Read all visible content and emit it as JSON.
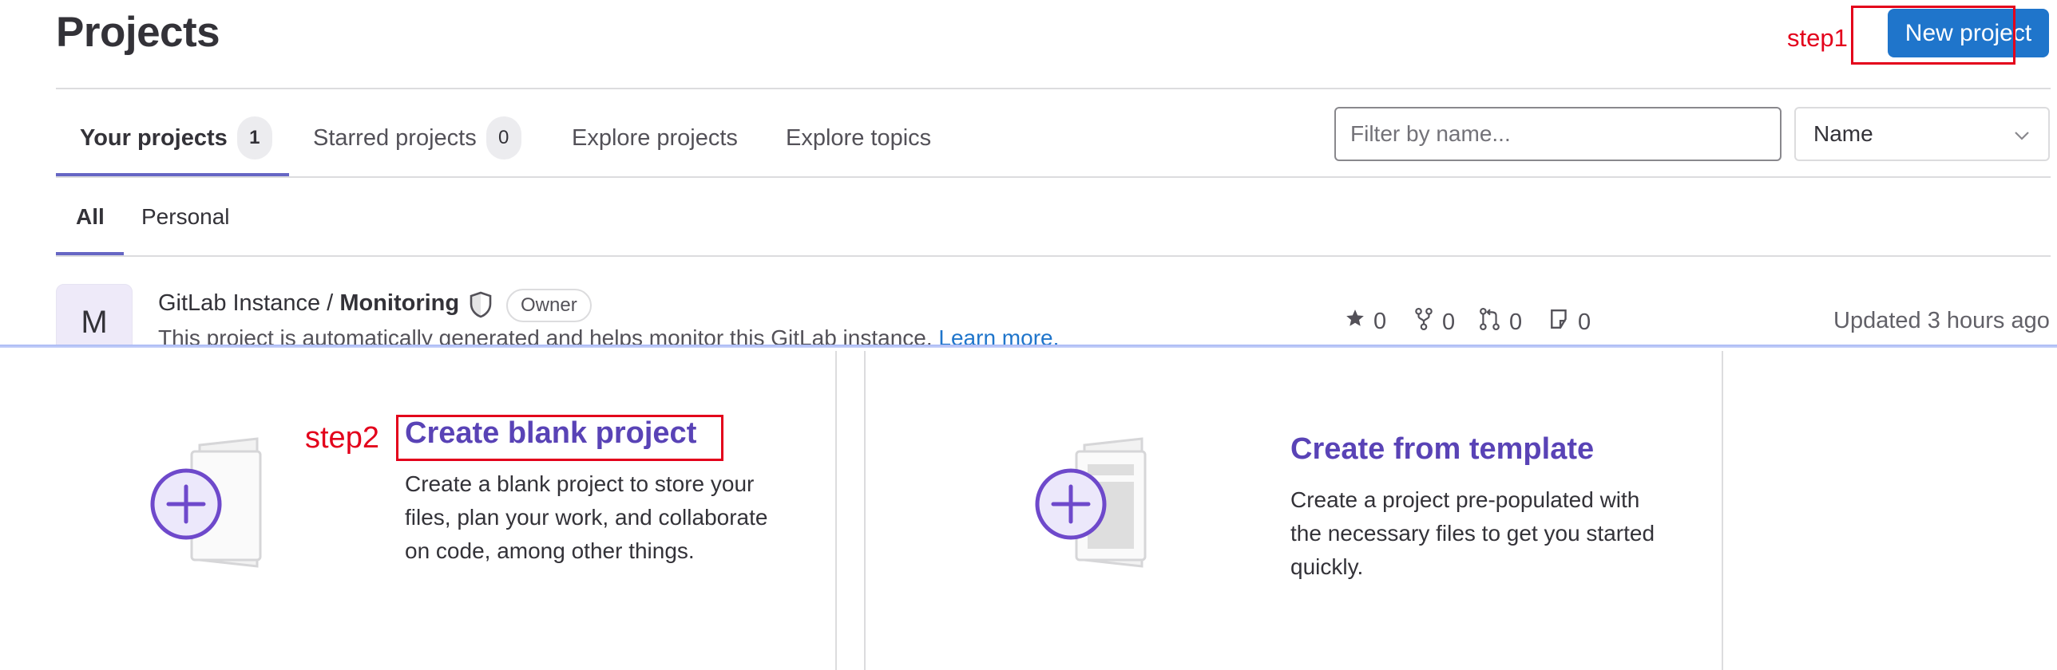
{
  "header": {
    "title": "Projects",
    "step1": "step1",
    "new_project": "New project"
  },
  "tabs": [
    {
      "label": "Your projects",
      "count": "1",
      "active": true
    },
    {
      "label": "Starred projects",
      "count": "0"
    },
    {
      "label": "Explore projects"
    },
    {
      "label": "Explore topics"
    }
  ],
  "filter": {
    "placeholder": "Filter by name...",
    "value": ""
  },
  "sort": {
    "selected": "Name"
  },
  "subtabs": [
    {
      "label": "All",
      "active": true
    },
    {
      "label": "Personal"
    }
  ],
  "project": {
    "avatar_letter": "M",
    "namespace": "GitLab Instance / ",
    "name": "Monitoring",
    "role": "Owner",
    "description": "This project is automatically generated and helps monitor this GitLab instance.",
    "learn_more": "Learn more.",
    "stars": "0",
    "forks": "0",
    "merge_requests": "0",
    "issues": "0",
    "updated": "Updated 3 hours ago"
  },
  "cards": {
    "step2": "step2",
    "blank": {
      "title": "Create blank project",
      "desc": "Create a blank project to store your files, plan your work, and collaborate on code, among other things."
    },
    "template": {
      "title": "Create from template",
      "desc": "Create a project pre-populated with the necessary files to get you started quickly."
    }
  },
  "colors": {
    "accent_blue": "#1f75cb",
    "annotation_red": "#e3001b",
    "card_title_purple": "#5943b6",
    "tab_underline": "#6666c4"
  }
}
